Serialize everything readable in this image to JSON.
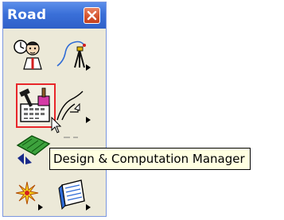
{
  "toolbox": {
    "title": "Road",
    "tools": [
      {
        "name": "surveyor-tool",
        "icon": "surveyor-person-icon"
      },
      {
        "name": "survey-path-tool",
        "icon": "survey-path-icon"
      },
      {
        "name": "design-computation-manager-tool",
        "icon": "hammer-brush-calculator-icon",
        "selected": true
      },
      {
        "name": "cross-section-tool",
        "icon": "curve-section-icon"
      },
      {
        "name": "mesh-tool",
        "icon": "green-terrain-icon"
      },
      {
        "name": "blank-tool",
        "icon": "blank-icon"
      },
      {
        "name": "sparkle-tool",
        "icon": "sparkle-icon"
      },
      {
        "name": "report-tool",
        "icon": "notepad-icon"
      }
    ]
  },
  "tooltip": {
    "text": "Design & Computation Manager"
  },
  "colors": {
    "titlebar": "#3a6fd8",
    "selected_outline": "#e8262a",
    "tooltip_bg": "#ffffe1",
    "toolbox_bg": "#ece9d8"
  }
}
